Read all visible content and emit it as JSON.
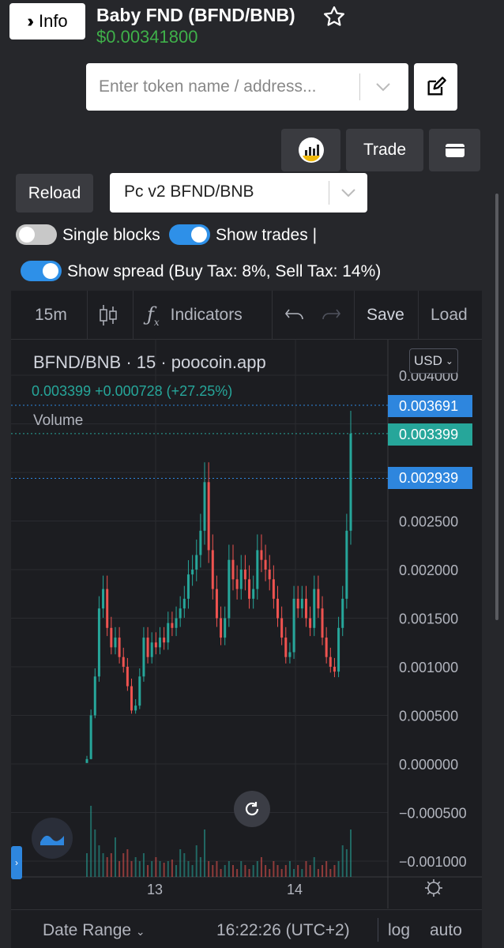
{
  "header": {
    "info_label": "Info",
    "title": "Baby FND (BFND/BNB)",
    "price": "$0.00341800"
  },
  "search": {
    "placeholder": "Enter token name / address..."
  },
  "actions": {
    "trade_label": "Trade",
    "reload_label": "Reload",
    "pair_selected": "Pc v2 BFND/BNB"
  },
  "toggles": {
    "single_blocks": {
      "label": "Single blocks",
      "on": false
    },
    "show_trades": {
      "label": "Show trades |",
      "on": true
    },
    "show_spread": {
      "label": "Show spread (Buy Tax: 8%, Sell Tax: 14%)",
      "on": true
    }
  },
  "toolbar": {
    "interval": "15m",
    "indicators": "Indicators",
    "save": "Save",
    "load": "Load"
  },
  "legend": {
    "title": "BFND/BNB · 15 · poocoin.app",
    "change": "0.003399 +0.000728 (+27.25%)",
    "volume": "Volume",
    "currency": "USD"
  },
  "price_tags": {
    "high": "0.003691",
    "last": "0.003399",
    "low": "0.002939"
  },
  "bottom": {
    "date_range": "Date Range",
    "time": "16:22:26 (UTC+2)",
    "log": "log",
    "auto": "auto"
  },
  "colors": {
    "up": "#26a69a",
    "down": "#ef5350",
    "price_positive": "#3fb04a",
    "accent": "#2e86de"
  },
  "chart_data": {
    "type": "candlestick",
    "x_ticks": [
      "13",
      "14"
    ],
    "y_ticks": [
      "0.004000",
      "0.002500",
      "0.002000",
      "0.001500",
      "0.001000",
      "0.000500",
      "0.000000",
      "−0.000500",
      "−0.001000"
    ],
    "ylim": [
      -0.001,
      0.004
    ],
    "close_series": [
      5e-05,
      0.0005,
      0.0009,
      0.0016,
      0.0018,
      0.0014,
      0.0012,
      0.0013,
      0.0011,
      0.001,
      0.0008,
      0.00055,
      0.0006,
      0.0009,
      0.0013,
      0.0011,
      0.00125,
      0.0012,
      0.0013,
      0.00125,
      0.00145,
      0.0014,
      0.0015,
      0.0016,
      0.0017,
      0.00195,
      0.002,
      0.00215,
      0.0024,
      0.0029,
      0.0022,
      0.0018,
      0.0015,
      0.0013,
      0.0015,
      0.0021,
      0.0019,
      0.0018,
      0.002,
      0.0019,
      0.0017,
      0.0018,
      0.0022,
      0.0021,
      0.002,
      0.0019,
      0.0017,
      0.0015,
      0.0013,
      0.0011,
      0.00115,
      0.0017,
      0.0016,
      0.0017,
      0.0015,
      0.0014,
      0.0018,
      0.0016,
      0.0013,
      0.0011,
      0.001,
      0.00095,
      0.0014,
      0.0017,
      0.0024,
      0.0034
    ],
    "volume_series": [
      0.3,
      0.9,
      0.6,
      0.4,
      0.3,
      0.25,
      0.3,
      0.5,
      0.2,
      0.3,
      0.35,
      0.2,
      0.25,
      0.2,
      0.3,
      0.15,
      0.2,
      0.25,
      0.2,
      0.18,
      0.2,
      0.22,
      0.15,
      0.35,
      0.3,
      0.2,
      0.15,
      0.4,
      0.25,
      0.6,
      0.2,
      0.15,
      0.2,
      0.1,
      0.15,
      0.2,
      0.15,
      0.1,
      0.2,
      0.15,
      0.1,
      0.15,
      0.2,
      0.25,
      0.15,
      0.1,
      0.2,
      0.15,
      0.1,
      0.15,
      0.2,
      0.1,
      0.15,
      0.1,
      0.2,
      0.15,
      0.25,
      0.1,
      0.15,
      0.2,
      0.1,
      0.15,
      0.2,
      0.4,
      0.35,
      0.6
    ]
  }
}
